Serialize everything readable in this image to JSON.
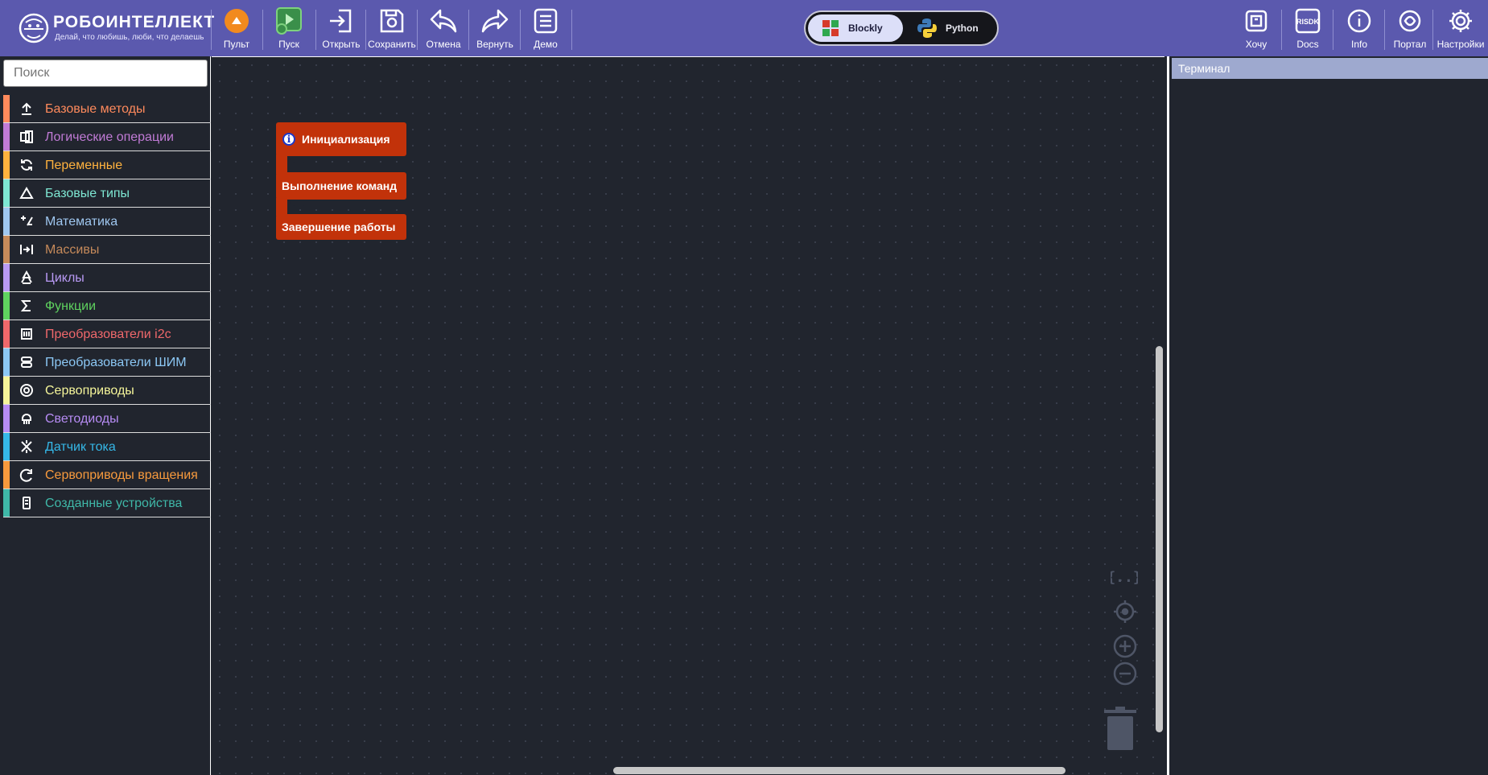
{
  "app": {
    "brand": "РОБОИНТЕЛЛЕКТ",
    "tagline": "Делай, что любишь, люби, что делаешь"
  },
  "toolbar": {
    "pult": "Пульт",
    "run": "Пуск",
    "open": "Открыть",
    "save": "Сохранить",
    "undo": "Отмена",
    "redo": "Вернуть",
    "demo": "Демо"
  },
  "mode": {
    "blockly": "Blockly",
    "python": "Python",
    "active": "Blockly"
  },
  "right_toolbar": {
    "want": "Хочу",
    "docs": "Docs",
    "docs_icon_text": "RISDK",
    "info": "Info",
    "portal": "Портал",
    "settings": "Настройки"
  },
  "sidebar": {
    "search_placeholder": "Поиск",
    "categories": [
      {
        "label": "Базовые методы",
        "color": "#ff8a5c",
        "icon": "upload-icon"
      },
      {
        "label": "Логические операции",
        "color": "#c17bd6",
        "icon": "logic-icon"
      },
      {
        "label": "Переменные",
        "color": "#ffb23e",
        "icon": "refresh-icon"
      },
      {
        "label": "Базовые типы",
        "color": "#7ee7d3",
        "icon": "triangle-icon"
      },
      {
        "label": "Математика",
        "color": "#9fc7f0",
        "icon": "math-icon"
      },
      {
        "label": "Массивы",
        "color": "#c68a5a",
        "icon": "array-icon"
      },
      {
        "label": "Циклы",
        "color": "#b99af5",
        "icon": "loop-icon"
      },
      {
        "label": "Функции",
        "color": "#5fd35f",
        "icon": "sigma-icon"
      },
      {
        "label": "Преобразователи i2c",
        "color": "#f0686b",
        "icon": "i2c-icon"
      },
      {
        "label": "Преобразователи ШИМ",
        "color": "#8cc8f5",
        "icon": "pwm-icon"
      },
      {
        "label": "Сервоприводы",
        "color": "#f5f59a",
        "icon": "gear-icon"
      },
      {
        "label": "Светодиоды",
        "color": "#b78cf5",
        "icon": "led-icon"
      },
      {
        "label": "Датчик тока",
        "color": "#35b8e8",
        "icon": "current-icon"
      },
      {
        "label": "Сервоприводы вращения",
        "color": "#f79a3d",
        "icon": "rotation-icon"
      },
      {
        "label": "Созданные устройства",
        "color": "#3fb8a8",
        "icon": "device-icon"
      }
    ]
  },
  "workspace": {
    "blocks": {
      "init": "Инициализация",
      "exec": "Выполнение команд",
      "end": "Завершение работы"
    },
    "block_color": "#c2320a"
  },
  "terminal": {
    "title": "Терминал"
  }
}
